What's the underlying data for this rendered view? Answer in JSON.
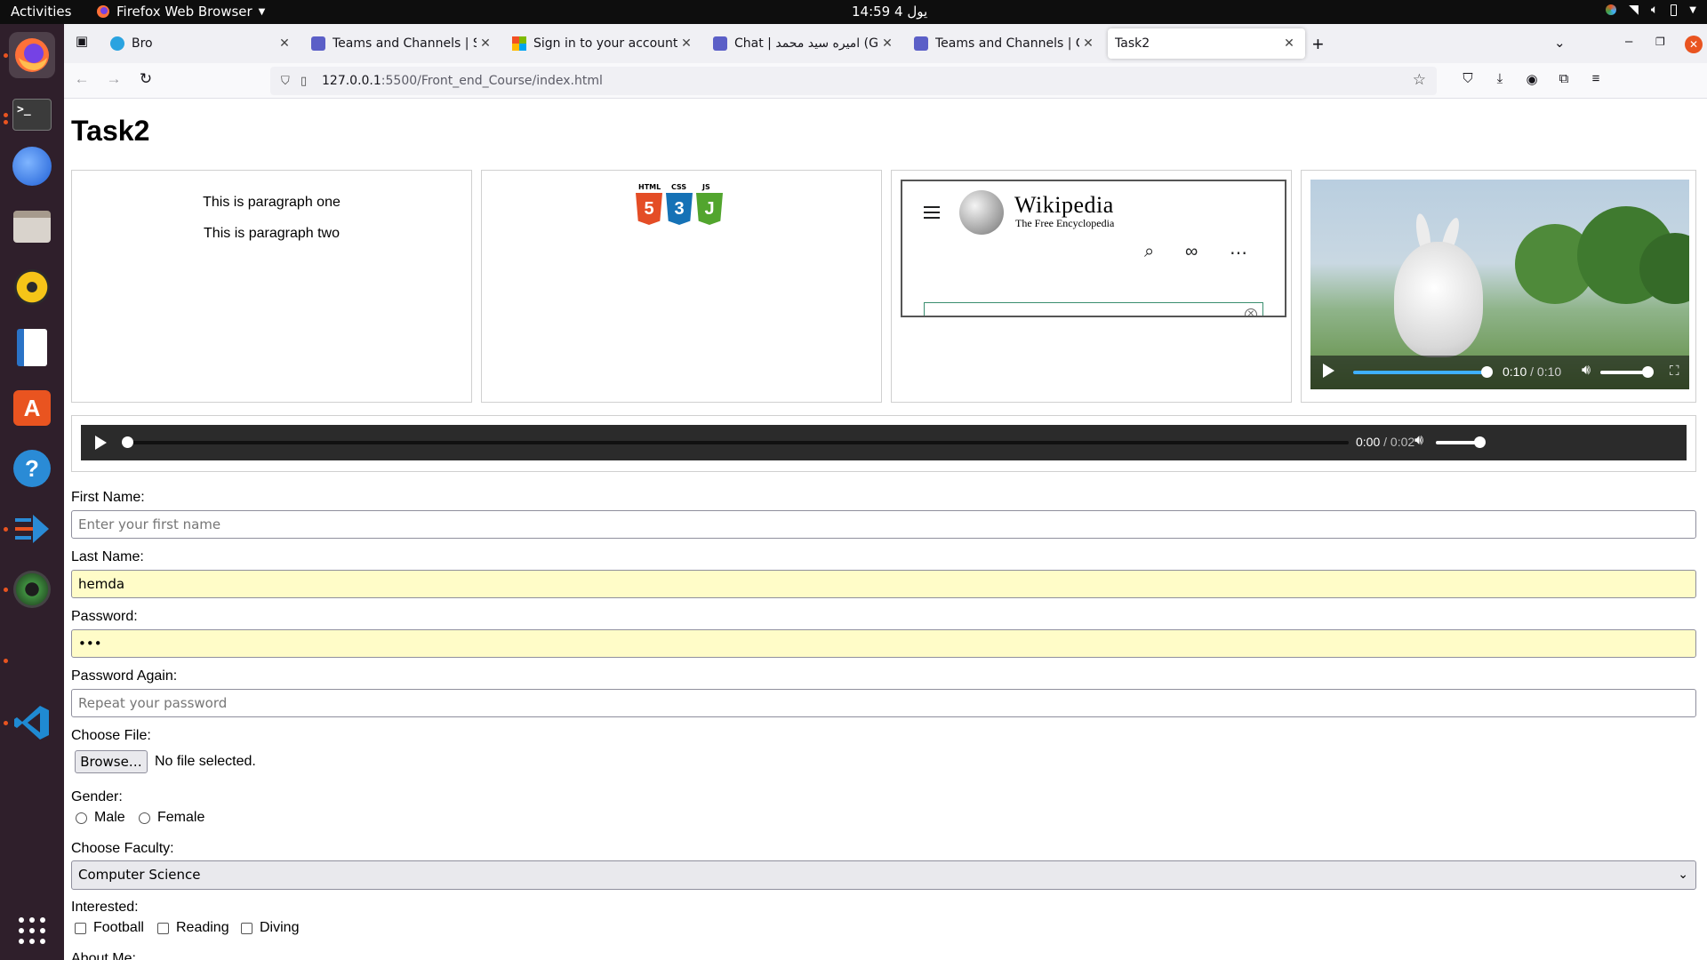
{
  "system": {
    "activities": "Activities",
    "app_name": "Firefox Web Browser",
    "clock": "14:59 يول 4"
  },
  "dock": {
    "icons": [
      "firefox-icon",
      "terminal-icon",
      "thunderbird-icon",
      "files-icon",
      "rhythmbox-icon",
      "writer-icon",
      "app-center-icon",
      "help-icon",
      "remote-desktop-icon",
      "camera-icon",
      "vscode-icon",
      "app-grid-icon"
    ]
  },
  "browser": {
    "tabs": [
      {
        "title": "Bro",
        "icon_color": "#2aa3e0"
      },
      {
        "title": "Teams and Channels | Set",
        "icon_color": "#5b5fc7"
      },
      {
        "title": "Sign in to your account",
        "icon_color": "#f25022"
      },
      {
        "title": "Chat | اميره سيد محمد (Gu",
        "icon_color": "#5b5fc7"
      },
      {
        "title": "Teams and Channels | Ge",
        "icon_color": "#5b5fc7"
      },
      {
        "title": "Task2",
        "icon_color": ""
      }
    ],
    "url_host": "127.0.0.1",
    "url_path": ":5500/Front_end_Course/index.html"
  },
  "page": {
    "heading": "Task2",
    "paragraphs": [
      "This is paragraph one",
      "This is paragraph two"
    ],
    "logos": [
      "HTML",
      "CSS",
      "JS"
    ],
    "wiki": {
      "wordmark": "Wikipedia",
      "tagline": "The Free Encyclopedia"
    },
    "video": {
      "current": "0:10",
      "duration": "/ 0:10",
      "progress": 1.0
    },
    "audio": {
      "current": "0:00",
      "duration": "/ 0:02",
      "progress": 0.0
    },
    "form": {
      "first_name_label": "First Name:",
      "first_name_placeholder": "Enter your first name",
      "last_name_label": "Last Name:",
      "last_name_value": "hemda",
      "password_label": "Password:",
      "password_value": "•••",
      "password_again_label": "Password Again:",
      "password_again_placeholder": "Repeat your password",
      "file_label": "Choose File:",
      "file_button": "Browse…",
      "file_status": "No file selected.",
      "gender_label": "Gender:",
      "gender_options": [
        "Male",
        "Female"
      ],
      "faculty_label": "Choose Faculty:",
      "faculty_selected": "Computer Science",
      "interested_label": "Interested:",
      "interests": [
        "Football",
        "Reading",
        "Diving"
      ],
      "about_label": "About Me:"
    }
  }
}
